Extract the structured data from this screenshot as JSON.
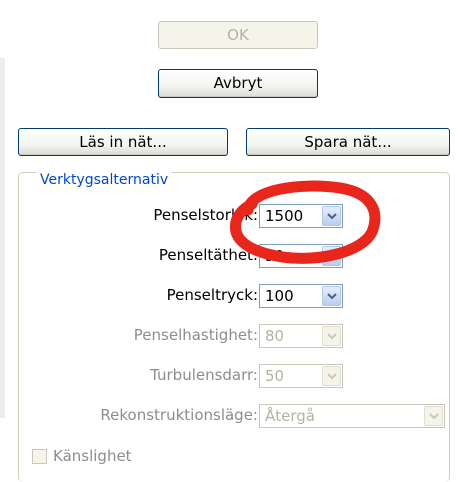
{
  "buttons": {
    "ok": "OK",
    "cancel": "Avbryt",
    "load_mesh": "Läs in nät...",
    "save_mesh": "Spara nät..."
  },
  "tool_options": {
    "legend": "Verktygsalternativ",
    "brush_size": {
      "label": "Penselstorlek:",
      "value": "1500"
    },
    "brush_density": {
      "label": "Penseltäthet:",
      "value": "50"
    },
    "brush_pressure": {
      "label": "Penseltryck:",
      "value": "100"
    },
    "brush_rate": {
      "label": "Penselhastighet:",
      "value": "80"
    },
    "turbulent_jitter": {
      "label": "Turbulensdarr:",
      "value": "50"
    },
    "reconstruct_mode": {
      "label": "Rekonstruktionsläge:",
      "value": "Återgå"
    },
    "sensitivity": {
      "label": "Känslighet",
      "checked": false
    }
  },
  "colors": {
    "annotation": "#e8261c",
    "accent": "#0046d5"
  }
}
